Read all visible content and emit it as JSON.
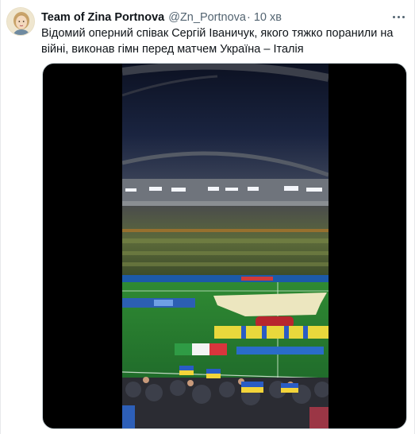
{
  "tweet": {
    "author": {
      "display_name": "Team of Zina Portnova",
      "handle": "@Zn_Portnova",
      "avatar_icon": "avatar-portrait-icon"
    },
    "separator": "·",
    "time": "10 хв",
    "text": "Відомий оперний співак Сергій Іваничук, якого тяжко поранили на війні, виконав гімн перед матчем Україна – Італія",
    "more_icon": "more-options-icon",
    "media": {
      "type": "video",
      "scene": "stadium-anthem-video-frame"
    }
  },
  "colors": {
    "text_primary": "#0f1419",
    "text_secondary": "#536471",
    "media_border": "#cfd9de"
  }
}
